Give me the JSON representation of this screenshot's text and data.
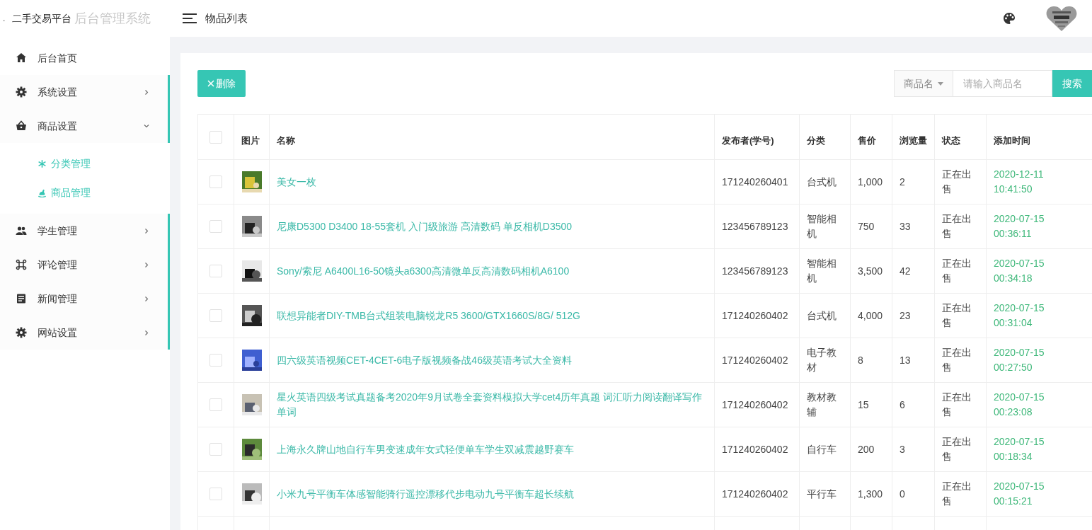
{
  "brand": {
    "dot": ".",
    "name": "二手交易平台",
    "subtitle": "后台管理系统"
  },
  "header": {
    "title": "物品列表"
  },
  "sidebar": {
    "items": [
      {
        "label": "后台首页",
        "kind": "home",
        "accent": false
      },
      {
        "label": "系统设置",
        "kind": "gear",
        "accent": true,
        "expanded": false
      },
      {
        "label": "商品设置",
        "kind": "basket",
        "accent": true,
        "expanded": true,
        "children": [
          {
            "label": "分类管理",
            "kind": "asterisk"
          },
          {
            "label": "商品管理",
            "kind": "horse"
          }
        ]
      },
      {
        "label": "学生管理",
        "kind": "people",
        "accent": true,
        "expanded": false
      },
      {
        "label": "评论管理",
        "kind": "command",
        "accent": true,
        "expanded": false
      },
      {
        "label": "新闻管理",
        "kind": "news",
        "accent": true,
        "expanded": false
      },
      {
        "label": "网站设置",
        "kind": "gear",
        "accent": true,
        "expanded": false
      }
    ]
  },
  "toolbar": {
    "delete_button": "删除",
    "search_field_select": "商品名",
    "search_placeholder": "请输入商品名",
    "search_button": "搜索"
  },
  "table": {
    "select_all_checked": false,
    "columns": [
      "图片",
      "名称",
      "发布者(学号)",
      "分类",
      "售价",
      "浏览量",
      "状态",
      "添加时间"
    ],
    "rows": [
      {
        "checked": false,
        "name": "美女一枚",
        "publisher": "171240260401",
        "category": "台式机",
        "price": "1,000",
        "views": "2",
        "status": "正在出售",
        "date": "2020-12-11",
        "time": "10:41:50"
      },
      {
        "checked": false,
        "name": "尼康D5300 D3400 18-55套机 入门级旅游 高清数码 单反相机D3500",
        "publisher": "123456789123",
        "category": "智能相机",
        "price": "750",
        "views": "33",
        "status": "正在出售",
        "date": "2020-07-15",
        "time": "00:36:11"
      },
      {
        "checked": false,
        "name": "Sony/索尼 A6400L16-50镜头a6300高清微单反高清数码相机A6100",
        "publisher": "123456789123",
        "category": "智能相机",
        "price": "3,500",
        "views": "42",
        "status": "正在出售",
        "date": "2020-07-15",
        "time": "00:34:18"
      },
      {
        "checked": false,
        "name": "联想异能者DIY-TMB台式组装电脑锐龙R5 3600/GTX1660S/8G/ 512G",
        "publisher": "171240260402",
        "category": "台式机",
        "price": "4,000",
        "views": "23",
        "status": "正在出售",
        "date": "2020-07-15",
        "time": "00:31:04"
      },
      {
        "checked": false,
        "name": "四六级英语视频CET-4CET-6电子版视频备战46级英语考试大全资料",
        "publisher": "171240260402",
        "category": "电子教材",
        "price": "8",
        "views": "13",
        "status": "正在出售",
        "date": "2020-07-15",
        "time": "00:27:50"
      },
      {
        "checked": false,
        "name": "星火英语四级考试真题备考2020年9月试卷全套资料模拟大学cet4历年真题 词汇听力阅读翻译写作单词",
        "publisher": "171240260402",
        "category": "教材教辅",
        "price": "15",
        "views": "6",
        "status": "正在出售",
        "date": "2020-07-15",
        "time": "00:23:08"
      },
      {
        "checked": false,
        "name": "上海永久牌山地自行车男变速成年女式轻便单车学生双减震越野赛车",
        "publisher": "171240260402",
        "category": "自行车",
        "price": "200",
        "views": "3",
        "status": "正在出售",
        "date": "2020-07-15",
        "time": "00:18:34"
      },
      {
        "checked": false,
        "name": "小米九号平衡车体感智能骑行遥控漂移代步电动九号平衡车超长续航",
        "publisher": "171240260402",
        "category": "平行车",
        "price": "1,300",
        "views": "0",
        "status": "正在出售",
        "date": "2020-07-15",
        "time": "00:15:21"
      }
    ]
  }
}
